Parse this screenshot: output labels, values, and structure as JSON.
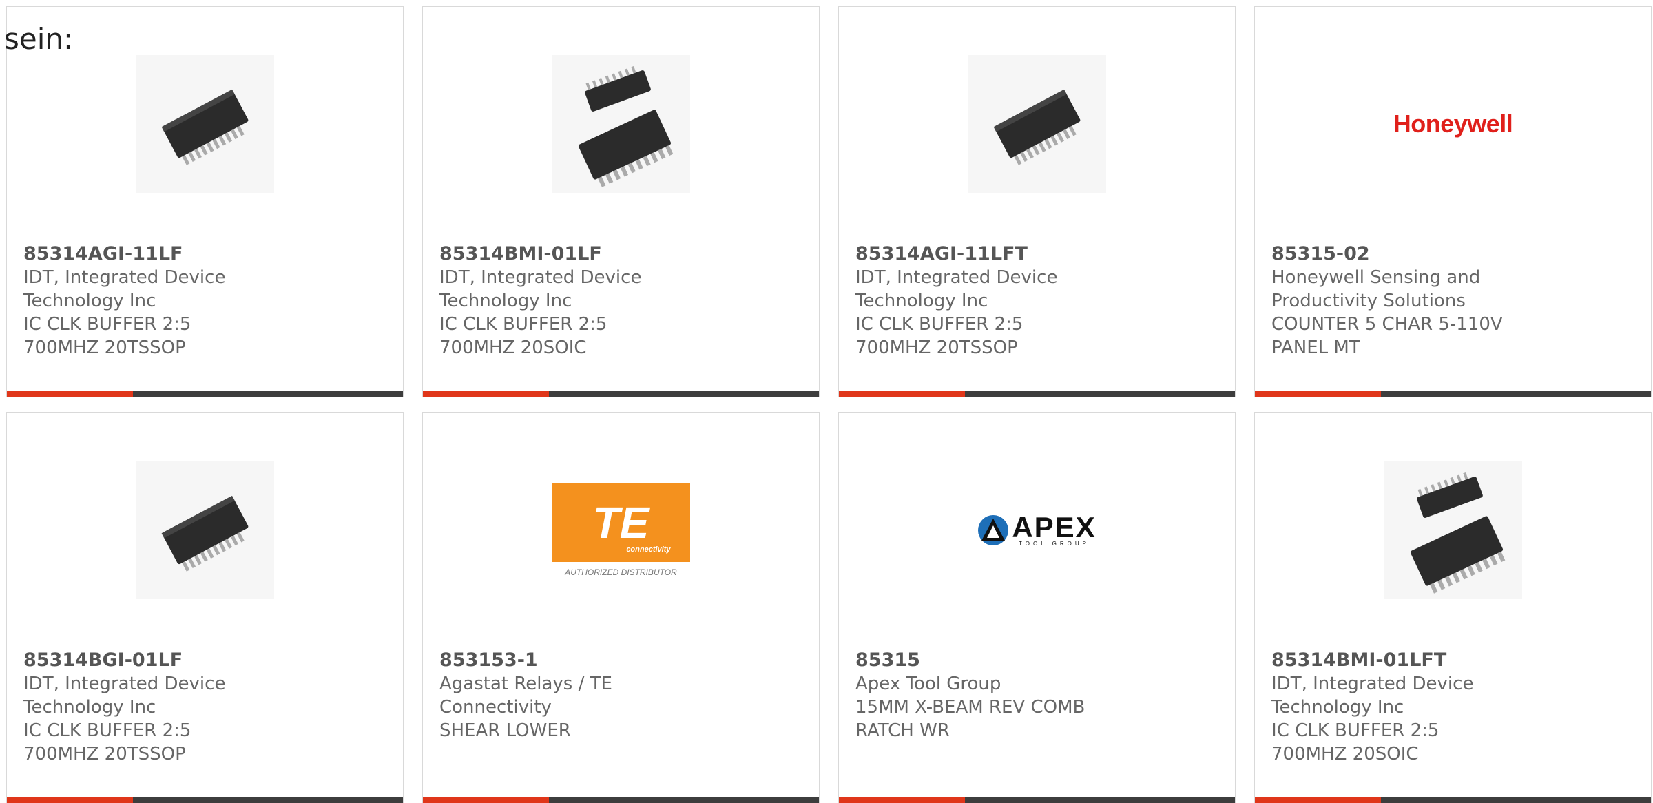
{
  "header": {
    "text": "sein:"
  },
  "cards": [
    {
      "part": "85314AGI-11LF",
      "manufacturer": "IDT, Integrated Device Technology Inc",
      "description": "IC CLK BUFFER 2:5 700MHZ 20TSSOP",
      "image": "tssop-chip"
    },
    {
      "part": "85314BMI-01LF",
      "manufacturer": "IDT, Integrated Device Technology Inc",
      "description": "IC CLK BUFFER 2:5 700MHZ 20SOIC",
      "image": "soic-chips"
    },
    {
      "part": "85314AGI-11LFT",
      "manufacturer": "IDT, Integrated Device Technology Inc",
      "description": "IC CLK BUFFER 2:5 700MHZ 20TSSOP",
      "image": "tssop-chip"
    },
    {
      "part": "85315-02",
      "manufacturer": "Honeywell Sensing and Productivity Solutions",
      "description": "COUNTER 5 CHAR 5-110V PANEL MT",
      "image": "honeywell-logo",
      "logo_text": "Honeywell"
    },
    {
      "part": "85314BGI-01LF",
      "manufacturer": "IDT, Integrated Device Technology Inc",
      "description": "IC CLK BUFFER 2:5 700MHZ 20TSSOP",
      "image": "tssop-chip"
    },
    {
      "part": "853153-1",
      "manufacturer": "Agastat Relays / TE Connectivity",
      "description": "SHEAR LOWER",
      "image": "te-logo",
      "logo_text": "TE",
      "logo_sub": "connectivity",
      "logo_caption": "AUTHORIZED DISTRIBUTOR"
    },
    {
      "part": "85315",
      "manufacturer": "Apex Tool Group",
      "description": "15MM X-BEAM REV COMB RATCH WR",
      "image": "apex-logo",
      "logo_text": "APEX",
      "logo_sub": "TOOL GROUP"
    },
    {
      "part": "85314BMI-01LFT",
      "manufacturer": "IDT, Integrated Device Technology Inc",
      "description": "IC CLK BUFFER 2:5 700MHZ 20SOIC",
      "image": "soic-chips"
    }
  ],
  "colors": {
    "accent": "#e0361a",
    "bar": "#3d3d3d",
    "honeywell_red": "#e0201b",
    "te_orange": "#f4911e"
  }
}
